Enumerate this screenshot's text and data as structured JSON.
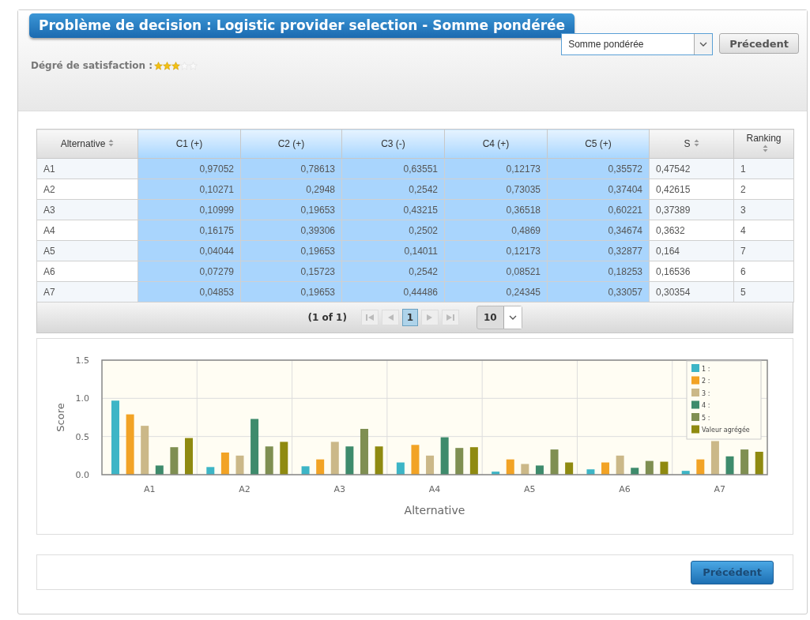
{
  "header": {
    "title": "Problème de decision : Logistic provider selection - Somme pondérée",
    "satisfaction_label": "Dégré de satisfaction :",
    "stars": 3,
    "method_select": {
      "value": "Somme pondérée"
    },
    "previous_button": "Précedent"
  },
  "table": {
    "columns": [
      {
        "label": "Alternative",
        "sortable": true,
        "highlighted": false
      },
      {
        "label": "C1 (+)",
        "sortable": false,
        "highlighted": true
      },
      {
        "label": "C2 (+)",
        "sortable": false,
        "highlighted": true
      },
      {
        "label": "C3 (-)",
        "sortable": false,
        "highlighted": true
      },
      {
        "label": "C4 (+)",
        "sortable": false,
        "highlighted": true
      },
      {
        "label": "C5 (+)",
        "sortable": false,
        "highlighted": true
      },
      {
        "label": "S",
        "sortable": true,
        "highlighted": false
      },
      {
        "label": "Ranking",
        "sortable": true,
        "highlighted": false
      }
    ],
    "rows": [
      [
        "A1",
        "0,97052",
        "0,78613",
        "0,63551",
        "0,12173",
        "0,35572",
        "0,47542",
        "1"
      ],
      [
        "A2",
        "0,10271",
        "0,2948",
        "0,2542",
        "0,73035",
        "0,37404",
        "0,42615",
        "2"
      ],
      [
        "A3",
        "0,10999",
        "0,19653",
        "0,43215",
        "0,36518",
        "0,60221",
        "0,37389",
        "3"
      ],
      [
        "A4",
        "0,16175",
        "0,39306",
        "0,2502",
        "0,4869",
        "0,34674",
        "0,3632",
        "4"
      ],
      [
        "A5",
        "0,04044",
        "0,19653",
        "0,14011",
        "0,12173",
        "0,32877",
        "0,164",
        "7"
      ],
      [
        "A6",
        "0,07279",
        "0,15723",
        "0,2542",
        "0,08521",
        "0,18253",
        "0,16536",
        "6"
      ],
      [
        "A7",
        "0,04853",
        "0,19653",
        "0,44486",
        "0,24345",
        "0,33057",
        "0,30354",
        "5"
      ]
    ],
    "paginator": {
      "page_report": "(1 of 1)",
      "pages": [
        {
          "label": "1",
          "selected": true
        }
      ],
      "rows_per_page": "10"
    }
  },
  "chart": {
    "chart_data": {
      "type": "bar",
      "xlabel": "Alternative",
      "ylabel": "Score",
      "categories": [
        "A1",
        "A2",
        "A3",
        "A4",
        "A5",
        "A6",
        "A7"
      ],
      "ylim": [
        0,
        1.5
      ],
      "yticks": [
        {
          "value": 0,
          "label": "0.0"
        },
        {
          "value": 0.5,
          "label": "0.5"
        },
        {
          "value": 1,
          "label": "1.0"
        },
        {
          "value": 1.5,
          "label": "1.5"
        }
      ],
      "legend": "upper right",
      "series": [
        {
          "name": "1 :",
          "color": "#3db5c6",
          "values": [
            0.97,
            0.1,
            0.11,
            0.16,
            0.04,
            0.07,
            0.05
          ]
        },
        {
          "name": "2 :",
          "color": "#f2a325",
          "values": [
            0.79,
            0.29,
            0.2,
            0.39,
            0.2,
            0.16,
            0.2
          ]
        },
        {
          "name": "3 :",
          "color": "#cbb888",
          "values": [
            0.64,
            0.25,
            0.43,
            0.25,
            0.14,
            0.25,
            0.44
          ]
        },
        {
          "name": "4 :",
          "color": "#3e8b6c",
          "values": [
            0.12,
            0.73,
            0.37,
            0.49,
            0.12,
            0.09,
            0.24
          ]
        },
        {
          "name": "5 :",
          "color": "#7f8f52",
          "values": [
            0.36,
            0.37,
            0.6,
            0.35,
            0.33,
            0.18,
            0.33
          ]
        },
        {
          "name": "Valeur agrégée",
          "color": "#8f8a10",
          "values": [
            0.48,
            0.43,
            0.37,
            0.36,
            0.16,
            0.17,
            0.3
          ]
        }
      ]
    }
  },
  "footer": {
    "previous_button": "Précédent"
  }
}
